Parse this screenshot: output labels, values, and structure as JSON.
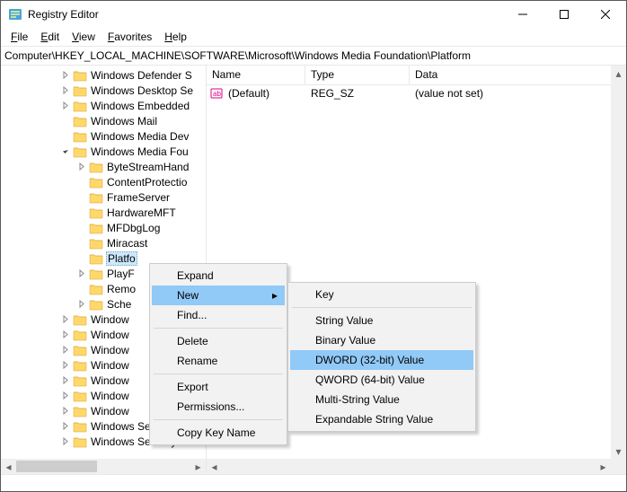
{
  "window": {
    "title": "Registry Editor"
  },
  "menu": {
    "file": "File",
    "edit": "Edit",
    "view": "View",
    "favorites": "Favorites",
    "help": "Help"
  },
  "address": "Computer\\HKEY_LOCAL_MACHINE\\SOFTWARE\\Microsoft\\Windows Media Foundation\\Platform",
  "tree": {
    "items": [
      {
        "ind": 2,
        "exp": "closed",
        "label": "Windows Defender S"
      },
      {
        "ind": 2,
        "exp": "closed",
        "label": "Windows Desktop Se"
      },
      {
        "ind": 2,
        "exp": "closed",
        "label": "Windows Embedded"
      },
      {
        "ind": 2,
        "exp": "none",
        "label": "Windows Mail"
      },
      {
        "ind": 2,
        "exp": "none",
        "label": "Windows Media Dev"
      },
      {
        "ind": 2,
        "exp": "open",
        "label": "Windows Media Fou"
      },
      {
        "ind": 3,
        "exp": "closed",
        "label": "ByteStreamHand"
      },
      {
        "ind": 3,
        "exp": "none",
        "label": "ContentProtectio"
      },
      {
        "ind": 3,
        "exp": "none",
        "label": "FrameServer"
      },
      {
        "ind": 3,
        "exp": "none",
        "label": "HardwareMFT"
      },
      {
        "ind": 3,
        "exp": "none",
        "label": "MFDbgLog"
      },
      {
        "ind": 3,
        "exp": "none",
        "label": "Miracast"
      },
      {
        "ind": 3,
        "exp": "none",
        "label": "Platfo",
        "sel": true
      },
      {
        "ind": 3,
        "exp": "closed",
        "label": "PlayF"
      },
      {
        "ind": 3,
        "exp": "none",
        "label": "Remo"
      },
      {
        "ind": 3,
        "exp": "closed",
        "label": "Sche"
      },
      {
        "ind": 2,
        "exp": "closed",
        "label": "Window"
      },
      {
        "ind": 2,
        "exp": "closed",
        "label": "Window"
      },
      {
        "ind": 2,
        "exp": "closed",
        "label": "Window"
      },
      {
        "ind": 2,
        "exp": "closed",
        "label": "Window"
      },
      {
        "ind": 2,
        "exp": "closed",
        "label": "Window"
      },
      {
        "ind": 2,
        "exp": "closed",
        "label": "Window"
      },
      {
        "ind": 2,
        "exp": "closed",
        "label": "Window"
      },
      {
        "ind": 2,
        "exp": "closed",
        "label": "Windows Search"
      },
      {
        "ind": 2,
        "exp": "closed",
        "label": "Windows Security H"
      }
    ]
  },
  "columns": {
    "name": "Name",
    "type": "Type",
    "data": "Data"
  },
  "values": {
    "row0": {
      "name": "(Default)",
      "type": "REG_SZ",
      "data": "(value not set)"
    }
  },
  "ctx": {
    "expand": "Expand",
    "new": "New",
    "find": "Find...",
    "delete": "Delete",
    "rename": "Rename",
    "export": "Export",
    "permissions": "Permissions...",
    "copy": "Copy Key Name"
  },
  "sub": {
    "key": "Key",
    "string": "String Value",
    "binary": "Binary Value",
    "dword": "DWORD (32-bit) Value",
    "qword": "QWORD (64-bit) Value",
    "multi": "Multi-String Value",
    "expand": "Expandable String Value"
  }
}
